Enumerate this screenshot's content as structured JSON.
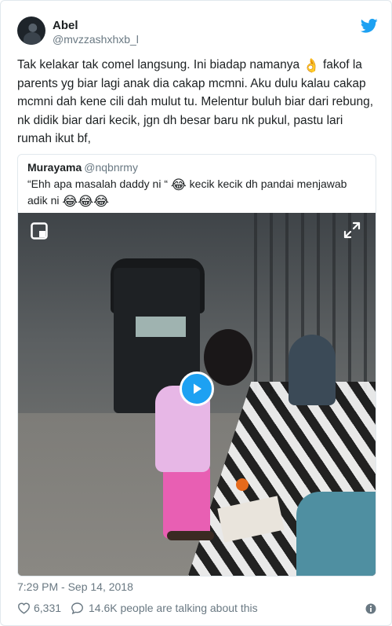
{
  "author": {
    "name": "Abel",
    "handle": "@mvzzashxhxb_l"
  },
  "tweet": {
    "text_before_emoji": "Tak kelakar tak comel langsung. Ini biadap namanya ",
    "emoji_ok": "👌",
    "text_after_emoji": " fakof la parents yg biar lagi anak dia cakap mcmni. Aku dulu kalau cakap mcmni dah kene cili dah mulut tu. Melentur buluh biar dari rebung, nk didik biar dari kecik, jgn dh besar baru nk pukul, pastu lari rumah ikut bf,"
  },
  "quoted_tweet": {
    "name": "Murayama",
    "handle": "@nqbnrmy",
    "text_part1": "“Ehh apa masalah daddy ni “ ",
    "emoji_1": "😂",
    "text_part2": " kecik kecik dh pandai menjawab adik ni ",
    "emoji_2": "😂😂😂"
  },
  "timestamp": "7:29 PM - Sep 14, 2018",
  "engagement": {
    "likes": "6,331",
    "talking": "14.6K people are talking about this"
  },
  "colors": {
    "accent": "#1da1f2",
    "secondary_text": "#697882",
    "border": "#e1e8ed"
  },
  "icons": [
    "twitter-bird-icon",
    "gif-corner-icon",
    "expand-icon",
    "play-icon",
    "heart-icon",
    "comment-icon",
    "info-icon"
  ]
}
